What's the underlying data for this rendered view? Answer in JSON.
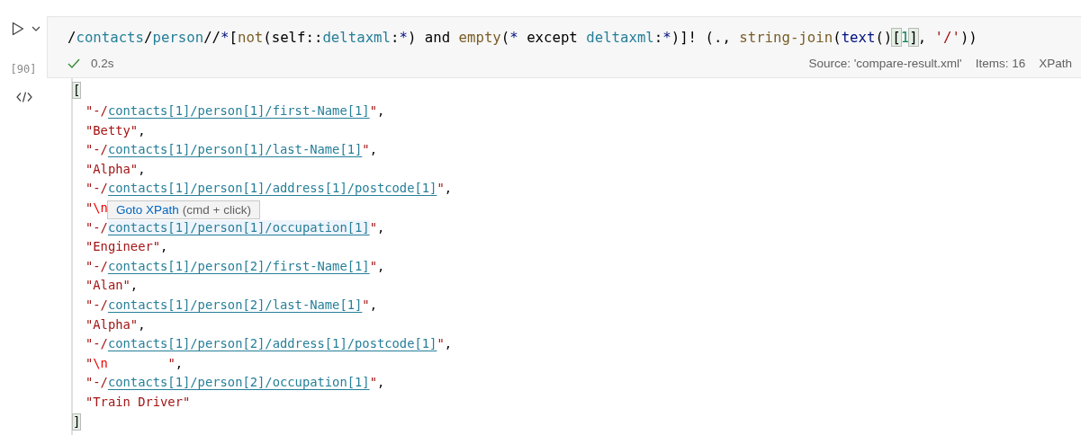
{
  "cell": {
    "execution_count": "[90]",
    "query": [
      {
        "kind": "plain",
        "text": "/"
      },
      {
        "kind": "name",
        "text": "contacts"
      },
      {
        "kind": "plain",
        "text": "/"
      },
      {
        "kind": "name",
        "text": "person"
      },
      {
        "kind": "plain",
        "text": "//"
      },
      {
        "kind": "keyword",
        "text": "*"
      },
      {
        "kind": "plain",
        "text": "["
      },
      {
        "kind": "func",
        "text": "not"
      },
      {
        "kind": "plain",
        "text": "(self::"
      },
      {
        "kind": "name",
        "text": "deltaxml"
      },
      {
        "kind": "plain",
        "text": ":"
      },
      {
        "kind": "keyword",
        "text": "*"
      },
      {
        "kind": "plain",
        "text": ") and "
      },
      {
        "kind": "func",
        "text": "empty"
      },
      {
        "kind": "plain",
        "text": "("
      },
      {
        "kind": "keyword",
        "text": "*"
      },
      {
        "kind": "plain",
        "text": " except "
      },
      {
        "kind": "name",
        "text": "deltaxml"
      },
      {
        "kind": "plain",
        "text": ":"
      },
      {
        "kind": "keyword",
        "text": "*"
      },
      {
        "kind": "plain",
        "text": ")]! (., "
      },
      {
        "kind": "func",
        "text": "string-join"
      },
      {
        "kind": "plain",
        "text": "("
      },
      {
        "kind": "keyword",
        "text": "text"
      },
      {
        "kind": "plain",
        "text": "()"
      },
      {
        "kind": "match",
        "text": "["
      },
      {
        "kind": "number",
        "text": "1"
      },
      {
        "kind": "match",
        "text": "]"
      },
      {
        "kind": "plain",
        "text": ", "
      },
      {
        "kind": "string",
        "text": "'/'"
      },
      {
        "kind": "plain",
        "text": "))"
      }
    ],
    "status": {
      "success": true,
      "duration": "0.2s",
      "source": "Source: 'compare-result.xml'",
      "items": "Items: 16",
      "language": "XPath"
    }
  },
  "output": {
    "open": "[",
    "close": "]",
    "lines": [
      [
        {
          "kind": "string",
          "text": "\"-/"
        },
        {
          "kind": "link",
          "text": "contacts[1]/person[1]/first-Name[1]",
          "hovered": false
        },
        {
          "kind": "string",
          "text": "\""
        },
        {
          "kind": "plain",
          "text": ","
        }
      ],
      [
        {
          "kind": "string",
          "text": "\"Betty\""
        },
        {
          "kind": "plain",
          "text": ","
        }
      ],
      [
        {
          "kind": "string",
          "text": "\"-/"
        },
        {
          "kind": "link",
          "text": "contacts[1]/person[1]/last-Name[1]",
          "hovered": false
        },
        {
          "kind": "string",
          "text": "\""
        },
        {
          "kind": "plain",
          "text": ","
        }
      ],
      [
        {
          "kind": "string",
          "text": "\"Alpha\""
        },
        {
          "kind": "plain",
          "text": ","
        }
      ],
      [
        {
          "kind": "string",
          "text": "\"-/"
        },
        {
          "kind": "link",
          "text": "contacts[1]/person[1]/address[1]/postcode[1]",
          "hovered": false
        },
        {
          "kind": "string",
          "text": "\""
        },
        {
          "kind": "plain",
          "text": ","
        }
      ],
      [
        {
          "kind": "string",
          "text": "\""
        },
        {
          "kind": "escape",
          "text": "\\n"
        }
      ],
      [
        {
          "kind": "string",
          "text": "\"-/"
        },
        {
          "kind": "link",
          "text": "contacts[1]/person[1]/occupation[1]",
          "hovered": true
        },
        {
          "kind": "string",
          "text": "\""
        },
        {
          "kind": "plain",
          "text": ","
        }
      ],
      [
        {
          "kind": "string",
          "text": "\"Engineer\""
        },
        {
          "kind": "plain",
          "text": ","
        }
      ],
      [
        {
          "kind": "string",
          "text": "\"-/"
        },
        {
          "kind": "link",
          "text": "contacts[1]/person[2]/first-Name[1]",
          "hovered": false
        },
        {
          "kind": "string",
          "text": "\""
        },
        {
          "kind": "plain",
          "text": ","
        }
      ],
      [
        {
          "kind": "string",
          "text": "\"Alan\""
        },
        {
          "kind": "plain",
          "text": ","
        }
      ],
      [
        {
          "kind": "string",
          "text": "\"-/"
        },
        {
          "kind": "link",
          "text": "contacts[1]/person[2]/last-Name[1]",
          "hovered": false
        },
        {
          "kind": "string",
          "text": "\""
        },
        {
          "kind": "plain",
          "text": ","
        }
      ],
      [
        {
          "kind": "string",
          "text": "\"Alpha\""
        },
        {
          "kind": "plain",
          "text": ","
        }
      ],
      [
        {
          "kind": "string",
          "text": "\"-/"
        },
        {
          "kind": "link",
          "text": "contacts[1]/person[2]/address[1]/postcode[1]",
          "hovered": false
        },
        {
          "kind": "string",
          "text": "\""
        },
        {
          "kind": "plain",
          "text": ","
        }
      ],
      [
        {
          "kind": "string",
          "text": "\""
        },
        {
          "kind": "escape",
          "text": "\\n"
        },
        {
          "kind": "string",
          "text": "        \""
        },
        {
          "kind": "plain",
          "text": ","
        }
      ],
      [
        {
          "kind": "string",
          "text": "\"-/"
        },
        {
          "kind": "link",
          "text": "contacts[1]/person[2]/occupation[1]",
          "hovered": false
        },
        {
          "kind": "string",
          "text": "\""
        },
        {
          "kind": "plain",
          "text": ","
        }
      ],
      [
        {
          "kind": "string",
          "text": "\"Train Driver\""
        }
      ]
    ]
  },
  "tooltip": {
    "link": "Goto XPath",
    "hint": "(cmd + click)"
  }
}
